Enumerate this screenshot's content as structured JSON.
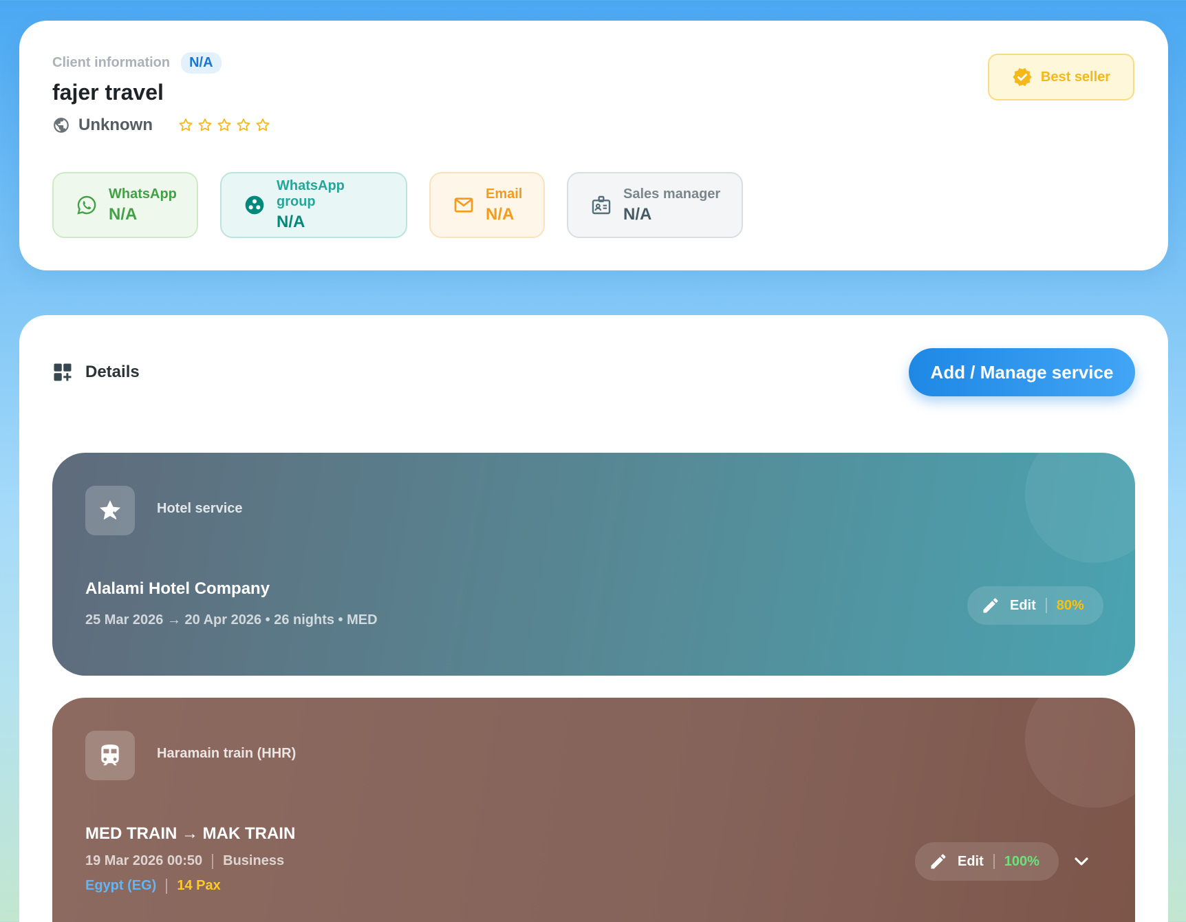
{
  "client": {
    "section_label": "Client information",
    "id_badge": "N/A",
    "name": "fajer travel",
    "location": "Unknown",
    "rating_stars": 5,
    "rating_filled": 0,
    "best_seller_label": "Best seller",
    "contacts": [
      {
        "label": "WhatsApp",
        "value": "N/A",
        "icon": "whatsapp-icon"
      },
      {
        "label": "WhatsApp group",
        "value": "N/A",
        "icon": "group-icon"
      },
      {
        "label": "Email",
        "value": "N/A",
        "icon": "mail-icon"
      },
      {
        "label": "Sales manager",
        "value": "N/A",
        "icon": "badge-icon"
      }
    ]
  },
  "details": {
    "title": "Details",
    "add_service_label": "Add / Manage service",
    "services": [
      {
        "type": "Hotel service",
        "name": "Alalami Hotel Company",
        "meta": "25 Mar 2026 → 20 Apr 2026 • 26 nights • MED",
        "edit_label": "Edit",
        "progress": "80%",
        "icon": "star-icon"
      },
      {
        "type": "Haramain train (HHR)",
        "name": "MED TRAIN → MAK TRAIN",
        "datetime": "19 Mar 2026 00:50",
        "class": "Business",
        "nationality": "Egypt (EG)",
        "pax": "14 Pax",
        "edit_label": "Edit",
        "progress": "100%",
        "icon": "train-icon"
      }
    ]
  },
  "colors": {
    "accent": "#1e88e5",
    "best_seller": "#f4b81b",
    "progress_partial": "#ffc107",
    "progress_full": "#69e37a"
  }
}
